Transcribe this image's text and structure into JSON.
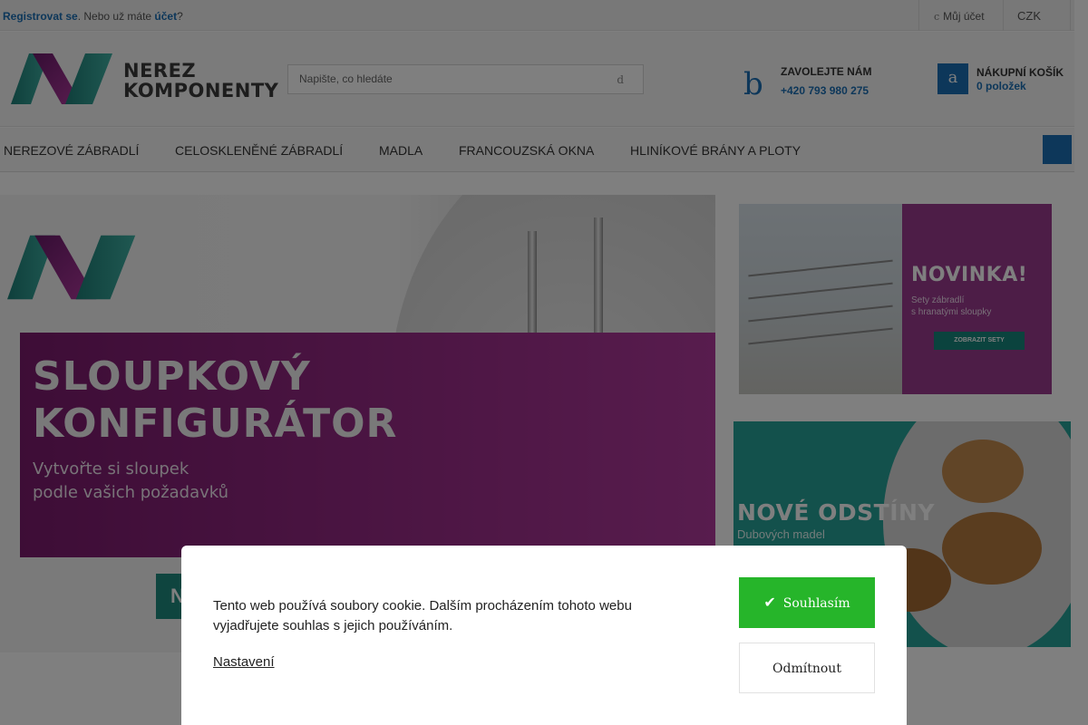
{
  "topbar": {
    "register_link": "Registrovat se",
    "register_mid": ". Nebo už máte ",
    "account_link": "účet",
    "register_end": "?",
    "my_account_icon": "c",
    "my_account_label": "Můj účet",
    "currency": "CZK",
    "currency_caret": ""
  },
  "header": {
    "logo": {
      "line1": "NEREZ",
      "line2": "KOMPONENTY"
    },
    "search": {
      "placeholder": "Napište, co hledáte",
      "icon": "d"
    },
    "phone": {
      "icon": "b",
      "title": "ZAVOLEJTE NÁM",
      "number": "+420 793 980 275"
    },
    "favorites_icon": "",
    "cart": {
      "icon": "a",
      "title": "NÁKUPNÍ KOŠÍK",
      "count": "0 položek"
    }
  },
  "nav": {
    "items": [
      {
        "label": "Nerezové zábradlí"
      },
      {
        "label": "Celoskleněné zábradlí"
      },
      {
        "label": "Madla"
      },
      {
        "label": "Francouzská okna"
      },
      {
        "label": "Hliníkové brány a ploty"
      }
    ],
    "menu_icon": ""
  },
  "banners": {
    "main": {
      "line1": "SLOUPKOVÝ",
      "line2": "KONFIGURÁTOR",
      "sub1": "Vytvořte si sloupek",
      "sub2": "podle vašich požadavků",
      "button_fragment": "N"
    },
    "side1": {
      "title": "NOVINKA!",
      "sub1": "Sety zábradlí",
      "sub2": "s hranatými sloupky",
      "button": "ZOBRAZIT SETY"
    },
    "side2": {
      "title": "NOVÉ ODSTÍNY",
      "sub": "Dubových madel"
    }
  },
  "cookie": {
    "text": "Tento web používá soubory cookie. Dalším procházením tohoto webu vyjadřujete souhlas s jejich používáním.",
    "settings": "Nastavení",
    "agree": "Souhlasím",
    "decline": "Odmítnout"
  },
  "colors": {
    "brand_blue": "#1b6fb5",
    "brand_purple": "#a2308f",
    "brand_teal": "#1f8a7e",
    "agree_green": "#26b52a"
  }
}
